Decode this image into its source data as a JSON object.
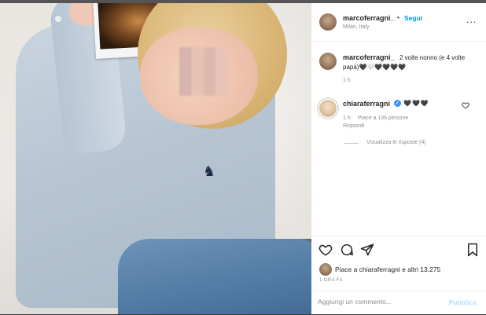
{
  "header": {
    "username": "marcoferragni_",
    "separator": "•",
    "follow_label": "Segui",
    "location": "Milan, Italy",
    "more_label": "..."
  },
  "caption": {
    "username": "marcoferragni_",
    "text": "2 volte nonno (e 4 volte papà)🖤🤍🖤🖤🖤🖤",
    "time": "1 h"
  },
  "comment": {
    "username": "chiaraferragni",
    "text": "🖤🖤🖤",
    "time": "1 h",
    "likes": "Piace a 136 persone",
    "reply_label": "Rispondi",
    "view_replies_label": "Visualizza le risposte (4)"
  },
  "likes": {
    "prefix": "Piace a ",
    "user": "chiaraferragni",
    "suffix": " e altri 13.275"
  },
  "timestamp": "1 ORA FA",
  "comment_input": {
    "placeholder": "Aggiungi un commento..."
  },
  "publish_label": "Pubblica",
  "icons": {
    "like": "heart-icon",
    "comment": "comment-icon",
    "share": "paper-plane-icon",
    "save": "bookmark-icon",
    "verified": "verified-badge-icon"
  },
  "colors": {
    "accent": "#0095f6",
    "publish_disabled": "#b2dffc",
    "text": "#262626",
    "muted": "#8e8e8e"
  }
}
